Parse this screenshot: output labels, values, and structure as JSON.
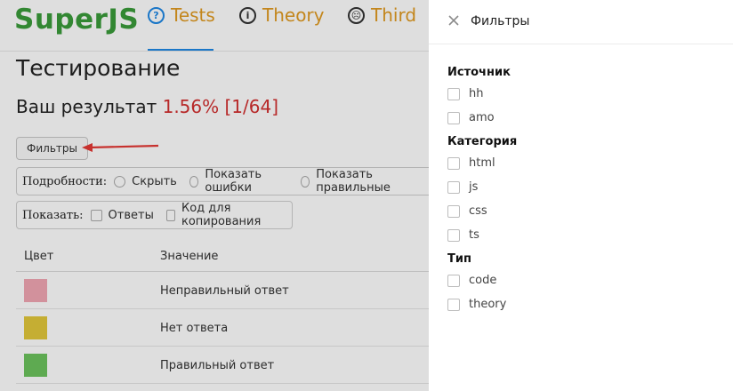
{
  "navbar": {
    "brand": "SuperJS",
    "items": [
      {
        "label": "Tests",
        "icon": "question-circle-icon",
        "glyph": "?",
        "active": true
      },
      {
        "label": "Theory",
        "icon": "info-circle-icon",
        "glyph": "i"
      },
      {
        "label": "Third",
        "icon": "frown-circle-icon",
        "glyph": "☹"
      }
    ]
  },
  "main": {
    "title": "Тестирование",
    "result_label": "Ваш результат",
    "result_value": "1.56% [1/64]",
    "filters_button": "Фильтры",
    "details": {
      "label": "Подробности:",
      "options": [
        "Скрыть",
        "Показать ошибки",
        "Показать правильные"
      ]
    },
    "show": {
      "label": "Показать:",
      "options": [
        "Ответы",
        "Код для копирования"
      ]
    },
    "legend": {
      "headers": [
        "Цвет",
        "Значение"
      ],
      "rows": [
        {
          "color": "#f2a7b4",
          "label": "Неправильный ответ"
        },
        {
          "color": "#e3c83b",
          "label": "Нет ответа"
        },
        {
          "color": "#6dc45e",
          "label": "Правильный ответ"
        }
      ]
    }
  },
  "drawer": {
    "title": "Фильтры",
    "sections": [
      {
        "title": "Источник",
        "items": [
          "hh",
          "amo"
        ]
      },
      {
        "title": "Категория",
        "items": [
          "html",
          "js",
          "css",
          "ts"
        ]
      },
      {
        "title": "Тип",
        "items": [
          "code",
          "theory"
        ]
      }
    ]
  },
  "colors": {
    "brand": "#3a9b3a",
    "nav_text": "#e19a21",
    "accent": "#1e88e5",
    "result_value": "#d32f2f",
    "arrow": "#e53935"
  }
}
